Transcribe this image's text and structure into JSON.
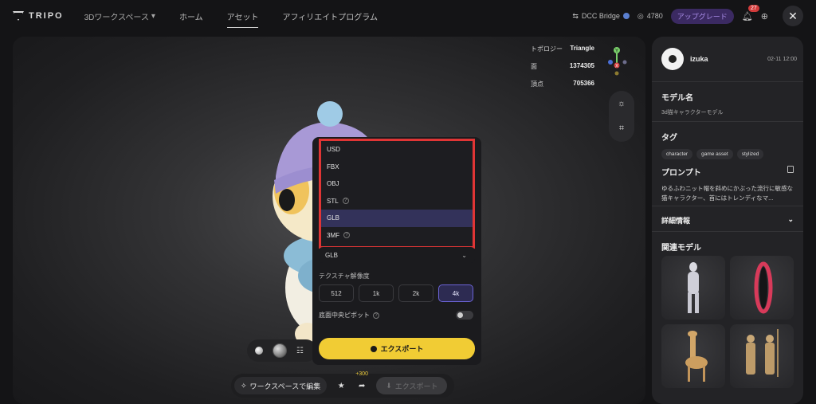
{
  "nav": {
    "brand": "TRIPO",
    "workspace": "3Dワークスペース",
    "links": [
      "ホーム",
      "アセット",
      "アフィリエイトプログラム"
    ],
    "dcc_bridge": "DCC Bridge",
    "credits": "4780",
    "upgrade": "アップグレード",
    "notif_count": "27"
  },
  "stats": {
    "topology_label": "トポロジー",
    "topology_value": "Triangle",
    "faces_label": "面",
    "faces_value": "1374305",
    "vertices_label": "頂点",
    "vertices_value": "705366"
  },
  "gizmo": {
    "y": "Y",
    "x": "X"
  },
  "formats": [
    {
      "label": "USD",
      "help": false
    },
    {
      "label": "FBX",
      "help": false
    },
    {
      "label": "OBJ",
      "help": false
    },
    {
      "label": "STL",
      "help": true
    },
    {
      "label": "GLB",
      "help": false,
      "selected": true
    },
    {
      "label": "3MF",
      "help": true
    }
  ],
  "export_panel": {
    "selected_format": "GLB",
    "texture_label": "テクスチャ解像度",
    "texture_options": [
      "512",
      "1k",
      "2k",
      "4k"
    ],
    "texture_selected": "4k",
    "pivot_label": "底面中央ピボット",
    "export_label": "エクスポート"
  },
  "action_bar": {
    "edit_label": "ワークスペースで編集",
    "bonus": "+300",
    "export_label": "エクスポート"
  },
  "model": {
    "user": "izuka",
    "date": "02-11 12:00",
    "name_title": "モデル名",
    "name_value": "3d猫キャラクターモデル",
    "tags_title": "タグ",
    "tags": [
      "character",
      "game asset",
      "stylized"
    ],
    "prompt_title": "プロンプト",
    "prompt_text": "ゆるふわニット帽を斜めにかぶった流行に敏感な猫キャラクター、首にはトレンディなマ...",
    "details_title": "詳細情報",
    "related_title": "関連モデル"
  },
  "colors": {
    "accent": "#f1cc34",
    "highlight": "#e03535",
    "selected": "#33325a"
  }
}
